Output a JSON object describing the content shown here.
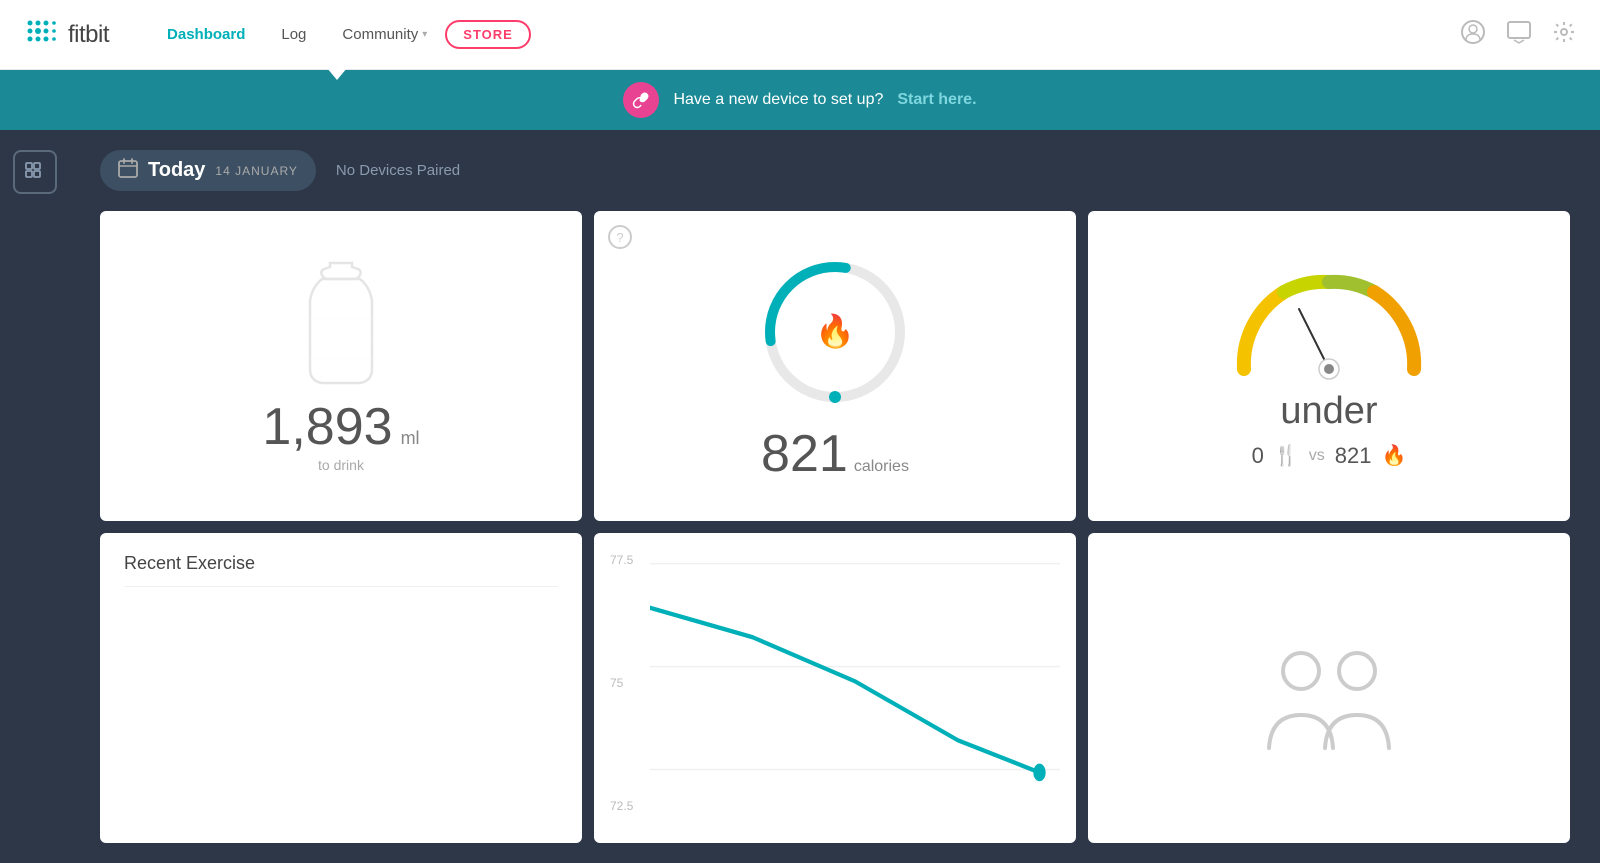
{
  "header": {
    "logo_text": "fitbit",
    "nav_items": [
      {
        "label": "Dashboard",
        "active": true
      },
      {
        "label": "Log",
        "active": false
      },
      {
        "label": "Community",
        "active": false,
        "has_dropdown": true
      },
      {
        "label": "STORE",
        "is_store": true
      }
    ],
    "icon_user": "👤",
    "icon_message": "💬",
    "icon_settings": "⚙"
  },
  "banner": {
    "text": "Have a new device to set up?",
    "link_text": "Start here.",
    "icon": "🔗"
  },
  "date_bar": {
    "today_label": "Today",
    "date_label": "14 JANUARY",
    "no_devices_text": "No Devices Paired",
    "calendar_icon": "📅"
  },
  "cards": {
    "water": {
      "value": "1,893",
      "unit": "ml",
      "label": "to drink"
    },
    "calories_burned": {
      "value": "821",
      "unit": "calories",
      "ring_percent": 30
    },
    "calorie_balance": {
      "status": "under",
      "food_calories": "0",
      "burned_calories": "821"
    },
    "recent_exercise": {
      "title": "Recent Exercise"
    },
    "weight_chart": {
      "y_labels": [
        "77.5",
        "75",
        "72.5"
      ],
      "line_value": 72.5
    },
    "friends": {
      "title": "Friends"
    }
  },
  "sidebar": {
    "grid_icon": "⊞"
  }
}
